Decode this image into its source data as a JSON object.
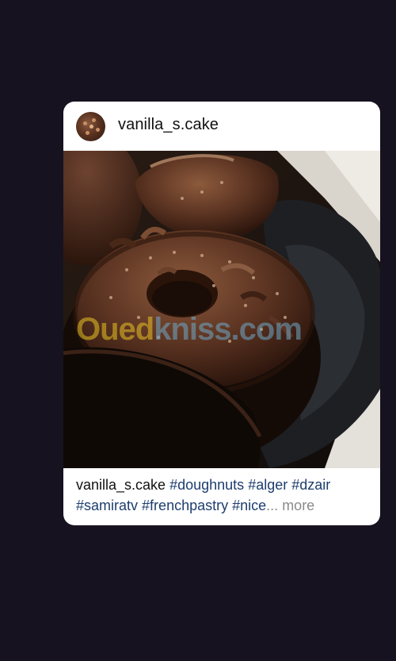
{
  "post": {
    "username": "vanilla_s.cake",
    "image_description_icon": "doughnut-photo",
    "watermark": {
      "part1": "Oued",
      "part2": "kniss",
      "part3": ".com"
    },
    "caption": {
      "username": "vanilla_s.cake",
      "tags": [
        "#doughnuts",
        "#alger",
        "#dzair",
        "#samiratv",
        "#frenchpastry",
        "#nice"
      ],
      "ellipsis": "...",
      "more_label": "more"
    }
  },
  "colors": {
    "background": "#17121f",
    "card": "#ffffff",
    "hashtag": "#1d3d6e",
    "more": "#8a8a8a",
    "watermark_yellow": "#e8c324",
    "watermark_blue": "#6fa8c8"
  }
}
